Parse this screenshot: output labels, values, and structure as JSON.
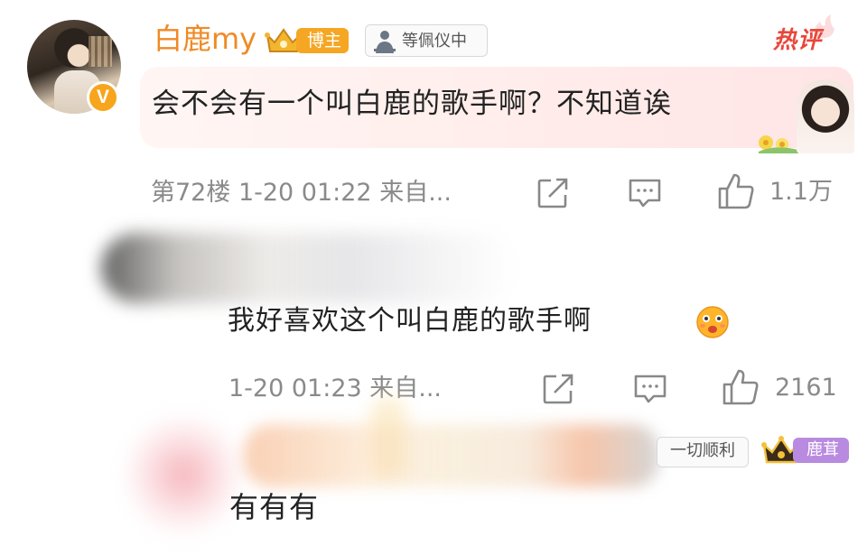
{
  "comments": [
    {
      "username": "白鹿my",
      "role_badge": "博主",
      "fan_badge": "等佩仪中",
      "hot_label": "热评",
      "text": "会不会有一个叫白鹿的歌手啊？不知道诶",
      "meta": "第72楼 1-20 01:22 来自...",
      "likes": "1.1万",
      "verified_badge": "V"
    },
    {
      "text": "我好喜欢这个叫白鹿的歌手啊",
      "meta": "1-20 01:23 来自...",
      "likes": "2161"
    },
    {
      "fan_badge": "一切顺利",
      "level_badge": "鹿茸",
      "text": "有有有"
    }
  ],
  "colors": {
    "username": "#f08a24",
    "role_badge": "#f5a623",
    "hot_label": "#e8473b",
    "level_badge": "#b98be0",
    "meta_text": "#8a8a8a"
  },
  "icons": [
    "share-icon",
    "reply-icon",
    "like-icon",
    "crown-icon",
    "fan-icon",
    "emoji-icon"
  ]
}
